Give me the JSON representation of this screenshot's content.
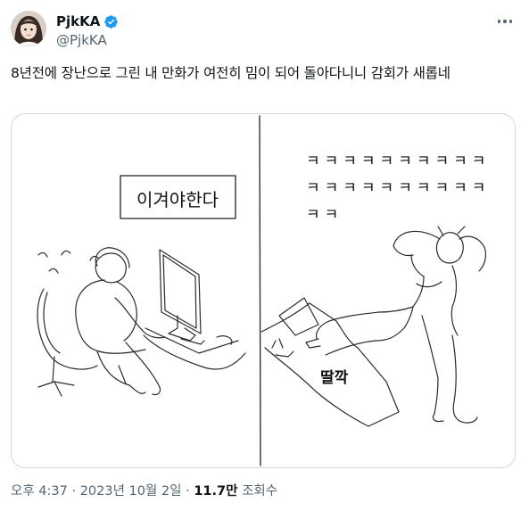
{
  "author": {
    "display_name": "PjkKA",
    "handle": "@PjkKA",
    "verified_color": "#1d9bf0"
  },
  "tweet": {
    "text": "8년전에 장난으로 그린 내 만화가 여전히 밈이 되어 돌아다니니 감회가 새롭네",
    "more_icon": "more-horizontal-icon"
  },
  "comic": {
    "left_panel": {
      "speech_box": "이겨야한다"
    },
    "right_panel": {
      "laugh_line_1": "ㅋㅋㅋㅋㅋㅋㅋㅋㅋㅋ",
      "laugh_line_2": "ㅋㅋㅋㅋㅋㅋㅋㅋㅋㅋ",
      "laugh_line_3": "ㅋㅋ",
      "sound_effect": "딸깍"
    }
  },
  "meta": {
    "time": "오후 4:37",
    "separator": "·",
    "date": "2023년 10월 2일",
    "views_count": "11.7만",
    "views_label": "조회수"
  }
}
